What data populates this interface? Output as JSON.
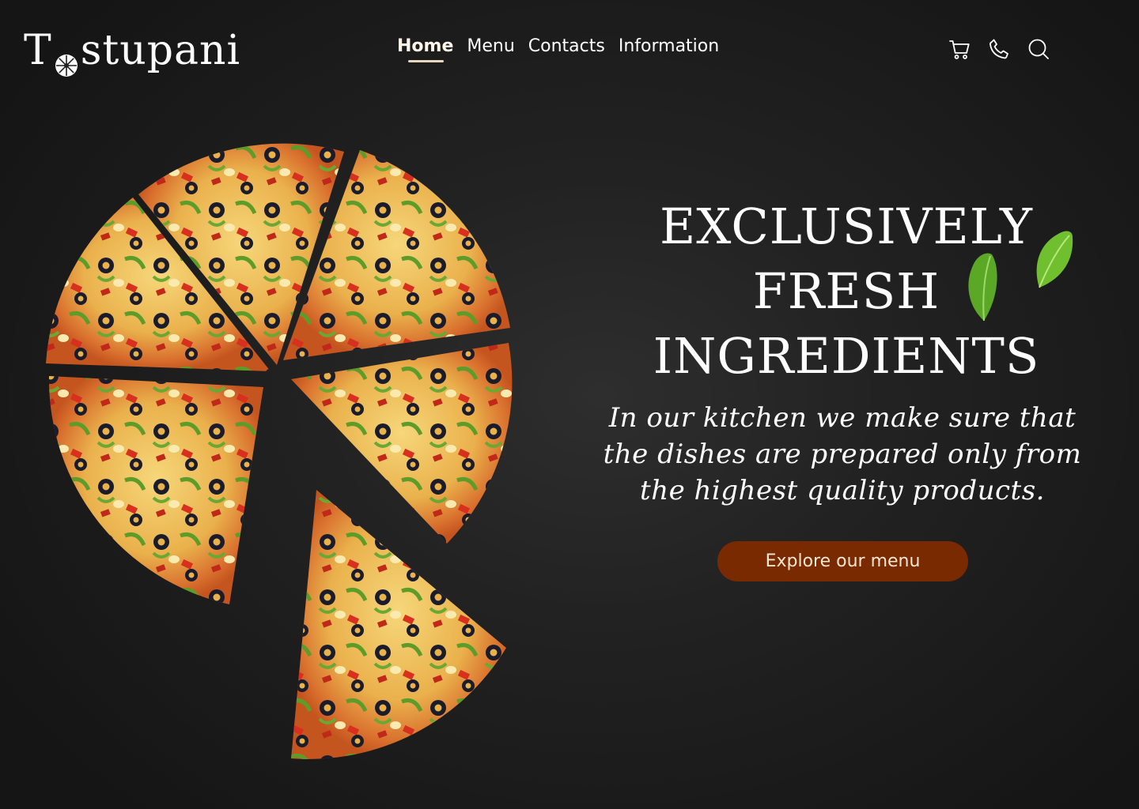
{
  "brand": {
    "name_left": "T",
    "name_right": "stupani",
    "logo_mark_icon": "pizza-wheel-icon"
  },
  "nav": {
    "items": [
      {
        "label": "Home",
        "active": true
      },
      {
        "label": "Menu",
        "active": false
      },
      {
        "label": "Contacts",
        "active": false
      },
      {
        "label": "Information",
        "active": false
      }
    ]
  },
  "header_icons": [
    "cart-icon",
    "phone-icon",
    "search-icon"
  ],
  "hero": {
    "title": "EXCLUSIVELY\nFRESH\nINGREDIENTS",
    "text": "In our kitchen we make sure that the dishes are prepared only from the highest quality products.",
    "cta_label": "Explore our menu"
  },
  "colors": {
    "background": "#1e1e1e",
    "cta_background": "#7a2a00",
    "accent_underline": "#e8d6bf",
    "leaf_green": "#6fbf2e"
  }
}
